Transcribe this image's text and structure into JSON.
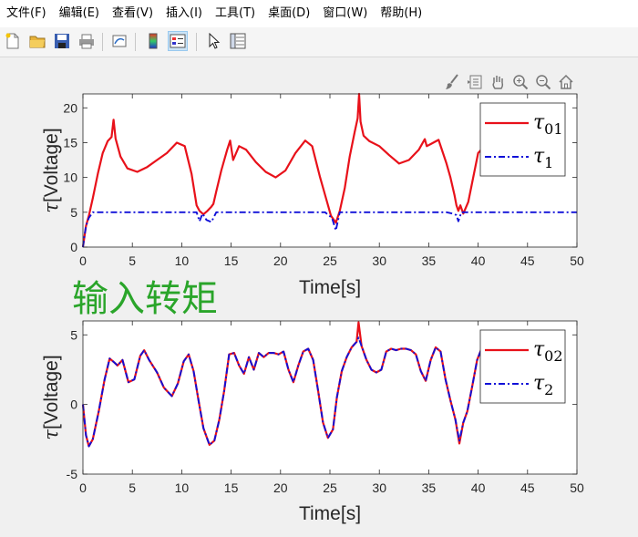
{
  "menu": {
    "items": [
      "文件(F)",
      "编辑(E)",
      "查看(V)",
      "插入(I)",
      "工具(T)",
      "桌面(D)",
      "窗口(W)",
      "帮助(H)"
    ]
  },
  "toolbar": {
    "icons": [
      "new-file-icon",
      "open-folder-icon",
      "save-icon",
      "print-icon",
      "link-plot-icon",
      "colorbar-icon",
      "legend-icon",
      "pointer-icon",
      "property-editor-icon"
    ]
  },
  "axes_toolbar": {
    "icons": [
      "brush-icon",
      "data-tips-icon",
      "pan-icon",
      "zoom-in-icon",
      "zoom-out-icon",
      "home-icon"
    ]
  },
  "annotation": "输入转矩",
  "colors": {
    "series_red": "#e8111a",
    "series_blue": "#1010d8",
    "annotation_green": "#2aa52a"
  },
  "chart_data": [
    {
      "type": "line",
      "xlabel": "Time[s]",
      "ylabel_symbol": "τ",
      "ylabel_text": "[Voltage]",
      "xlim": [
        0,
        50
      ],
      "ylim": [
        0,
        22
      ],
      "xticks": [
        "0",
        "5",
        "10",
        "15",
        "20",
        "25",
        "30",
        "35",
        "40",
        "45",
        "50"
      ],
      "yticks": [
        "0",
        "5",
        "10",
        "15",
        "20"
      ],
      "legend_position": "top-right",
      "series": [
        {
          "name": "τ01",
          "symbol": "τ",
          "subscript": "01",
          "color": "#e8111a",
          "style": "solid",
          "x": [
            0,
            0.3,
            0.6,
            1,
            1.5,
            2,
            2.5,
            2.9,
            3.1,
            3.3,
            3.8,
            4.5,
            5.5,
            6.5,
            7.5,
            8.5,
            9.5,
            10.3,
            11,
            11.5,
            11.8,
            12.2,
            12.6,
            13,
            13.2,
            13.5,
            14,
            14.6,
            14.9,
            15.2,
            15.8,
            16.5,
            17.5,
            18.5,
            19.5,
            20.5,
            21.5,
            22.5,
            23.2,
            24,
            24.6,
            25.1,
            25.6,
            26,
            26.5,
            27,
            27.5,
            27.8,
            27.95,
            28.1,
            28.4,
            29,
            30,
            31,
            32,
            33,
            34,
            34.6,
            34.8,
            35.2,
            36,
            36.8,
            37.2,
            37.6,
            37.8,
            38,
            38.2,
            38.5,
            39,
            39.5,
            40,
            41,
            41.5
          ],
          "y": [
            0,
            3,
            4.5,
            7,
            10.5,
            13.5,
            15.2,
            15.8,
            18.3,
            15.6,
            13,
            11.3,
            10.8,
            11.5,
            12.5,
            13.5,
            15,
            14.5,
            10.5,
            6,
            5.2,
            4.7,
            5.2,
            5.8,
            6.2,
            8,
            11,
            14,
            15.3,
            12.5,
            14.5,
            14,
            12.2,
            10.8,
            10,
            11,
            13.5,
            15.3,
            14.5,
            10,
            7,
            4.5,
            3.5,
            5.2,
            8.5,
            13,
            16.5,
            18.5,
            22,
            18,
            16,
            15.2,
            14.5,
            13.2,
            12,
            12.5,
            14,
            15.5,
            14.5,
            14.8,
            15.4,
            12,
            10,
            7.5,
            6,
            5.2,
            6,
            4.8,
            6.5,
            10,
            13.5,
            15,
            15.5
          ]
        },
        {
          "name": "τ1",
          "symbol": "τ",
          "subscript": "1",
          "color": "#1010d8",
          "style": "dashdot",
          "x": [
            0,
            0.15,
            0.3,
            0.6,
            1,
            10.5,
            11.5,
            11.8,
            12.1,
            12.5,
            13,
            13.5,
            24.5,
            25.2,
            25.6,
            26,
            36.8,
            37.4,
            37.8,
            38,
            38.3,
            38.8,
            50
          ],
          "y": [
            0,
            1.5,
            3,
            4.2,
            5,
            5,
            5,
            3.7,
            4.8,
            3.9,
            3.6,
            5,
            5,
            4.2,
            2.4,
            5,
            5,
            4.8,
            4.6,
            3.7,
            5,
            5,
            5
          ]
        }
      ]
    },
    {
      "type": "line",
      "xlabel": "Time[s]",
      "ylabel_symbol": "τ",
      "ylabel_text": "[Voltage]",
      "xlim": [
        0,
        50
      ],
      "ylim": [
        -5,
        6
      ],
      "xticks": [
        "0",
        "5",
        "10",
        "15",
        "20",
        "25",
        "30",
        "35",
        "40",
        "45",
        "50"
      ],
      "yticks": [
        "-5",
        "0",
        "5"
      ],
      "legend_position": "top-right",
      "series": [
        {
          "name": "τ02",
          "symbol": "τ",
          "subscript": "02",
          "color": "#e8111a",
          "style": "solid",
          "x": [
            0,
            0.3,
            0.6,
            1,
            1.6,
            2.2,
            2.7,
            3.2,
            3.5,
            4,
            4.6,
            5.2,
            5.8,
            6.2,
            6.7,
            7.5,
            8.2,
            9,
            9.6,
            10.2,
            10.7,
            11.2,
            11.7,
            12.2,
            12.8,
            13.3,
            13.8,
            14.3,
            14.8,
            15.3,
            15.8,
            16.3,
            16.8,
            17.3,
            17.8,
            18.3,
            18.8,
            19.3,
            19.8,
            20.3,
            20.8,
            21.3,
            21.8,
            22.3,
            22.8,
            23.3,
            23.8,
            24.3,
            24.8,
            25.3,
            25.7,
            26.2,
            26.7,
            27.2,
            27.7,
            27.9,
            28.2,
            28.7,
            29.2,
            29.7,
            30.2,
            30.7,
            31.2,
            31.7,
            32.2,
            32.7,
            33.2,
            33.7,
            34.2,
            34.7,
            35.2,
            35.7,
            36.2,
            36.7,
            37.2,
            37.7,
            38.1,
            38.5,
            38.9,
            39.4,
            39.9,
            40.4,
            40.9,
            41.4
          ],
          "y": [
            0,
            -2.2,
            -3,
            -2.5,
            -0.5,
            1.8,
            3.3,
            3,
            2.8,
            3.2,
            1.6,
            1.8,
            3.5,
            3.9,
            3.2,
            2.3,
            1.2,
            0.6,
            1.5,
            3.1,
            3.6,
            2.4,
            0.3,
            -1.7,
            -2.9,
            -2.6,
            -1.1,
            1,
            3.6,
            3.7,
            2.8,
            2.2,
            3.4,
            2.5,
            3.7,
            3.4,
            3.7,
            3.7,
            3.6,
            3.8,
            2.5,
            1.6,
            2.8,
            3.8,
            4,
            3.2,
            1,
            -1.3,
            -2.4,
            -1.8,
            0.5,
            2.4,
            3.4,
            4.1,
            4.5,
            5.9,
            4.2,
            3.2,
            2.5,
            2.3,
            2.5,
            3.8,
            4,
            3.9,
            4,
            4,
            3.9,
            3.6,
            2.4,
            1.7,
            3.2,
            4.1,
            3.8,
            1.8,
            0.3,
            -1.1,
            -2.8,
            -1.3,
            -0.5,
            1.3,
            3.2,
            4.1,
            4.2,
            3.8
          ]
        },
        {
          "name": "τ2",
          "symbol": "τ",
          "subscript": "2",
          "color": "#1010d8",
          "style": "dashdot",
          "x": [
            0,
            0.3,
            0.6,
            1,
            1.6,
            2.2,
            2.7,
            3.2,
            3.5,
            4,
            4.6,
            5.2,
            5.8,
            6.2,
            6.7,
            7.5,
            8.2,
            9,
            9.6,
            10.2,
            10.7,
            11.2,
            11.7,
            12.2,
            12.8,
            13.3,
            13.8,
            14.3,
            14.8,
            15.3,
            15.8,
            16.3,
            16.8,
            17.3,
            17.8,
            18.3,
            18.8,
            19.3,
            19.8,
            20.3,
            20.8,
            21.3,
            21.8,
            22.3,
            22.8,
            23.3,
            23.8,
            24.3,
            24.8,
            25.3,
            25.7,
            26.2,
            26.7,
            27.2,
            27.7,
            27.9,
            28.2,
            28.7,
            29.2,
            29.7,
            30.2,
            30.7,
            31.2,
            31.7,
            32.2,
            32.7,
            33.2,
            33.7,
            34.2,
            34.7,
            35.2,
            35.7,
            36.2,
            36.7,
            37.2,
            37.7,
            38.1,
            38.5,
            38.9,
            39.4,
            39.9,
            40.4,
            40.9,
            41.4
          ],
          "y": [
            0,
            -2.2,
            -3,
            -2.5,
            -0.5,
            1.8,
            3.3,
            3,
            2.8,
            3.2,
            1.6,
            1.8,
            3.5,
            3.9,
            3.2,
            2.3,
            1.2,
            0.6,
            1.5,
            3.1,
            3.6,
            2.4,
            0.3,
            -1.7,
            -2.9,
            -2.6,
            -1.1,
            1,
            3.6,
            3.7,
            2.8,
            2.2,
            3.4,
            2.5,
            3.7,
            3.4,
            3.7,
            3.7,
            3.6,
            3.8,
            2.5,
            1.6,
            2.8,
            3.8,
            4,
            3.2,
            1,
            -1.3,
            -2.4,
            -1.8,
            0.5,
            2.4,
            3.4,
            4.1,
            4.5,
            4.8,
            4.2,
            3.2,
            2.5,
            2.3,
            2.5,
            3.8,
            4,
            3.9,
            4,
            4,
            3.9,
            3.6,
            2.4,
            1.7,
            3.2,
            4.1,
            3.8,
            1.8,
            0.3,
            -1.1,
            -2.6,
            -1.3,
            -0.5,
            1.3,
            3.2,
            4.1,
            4.2,
            3.8
          ]
        }
      ]
    }
  ]
}
